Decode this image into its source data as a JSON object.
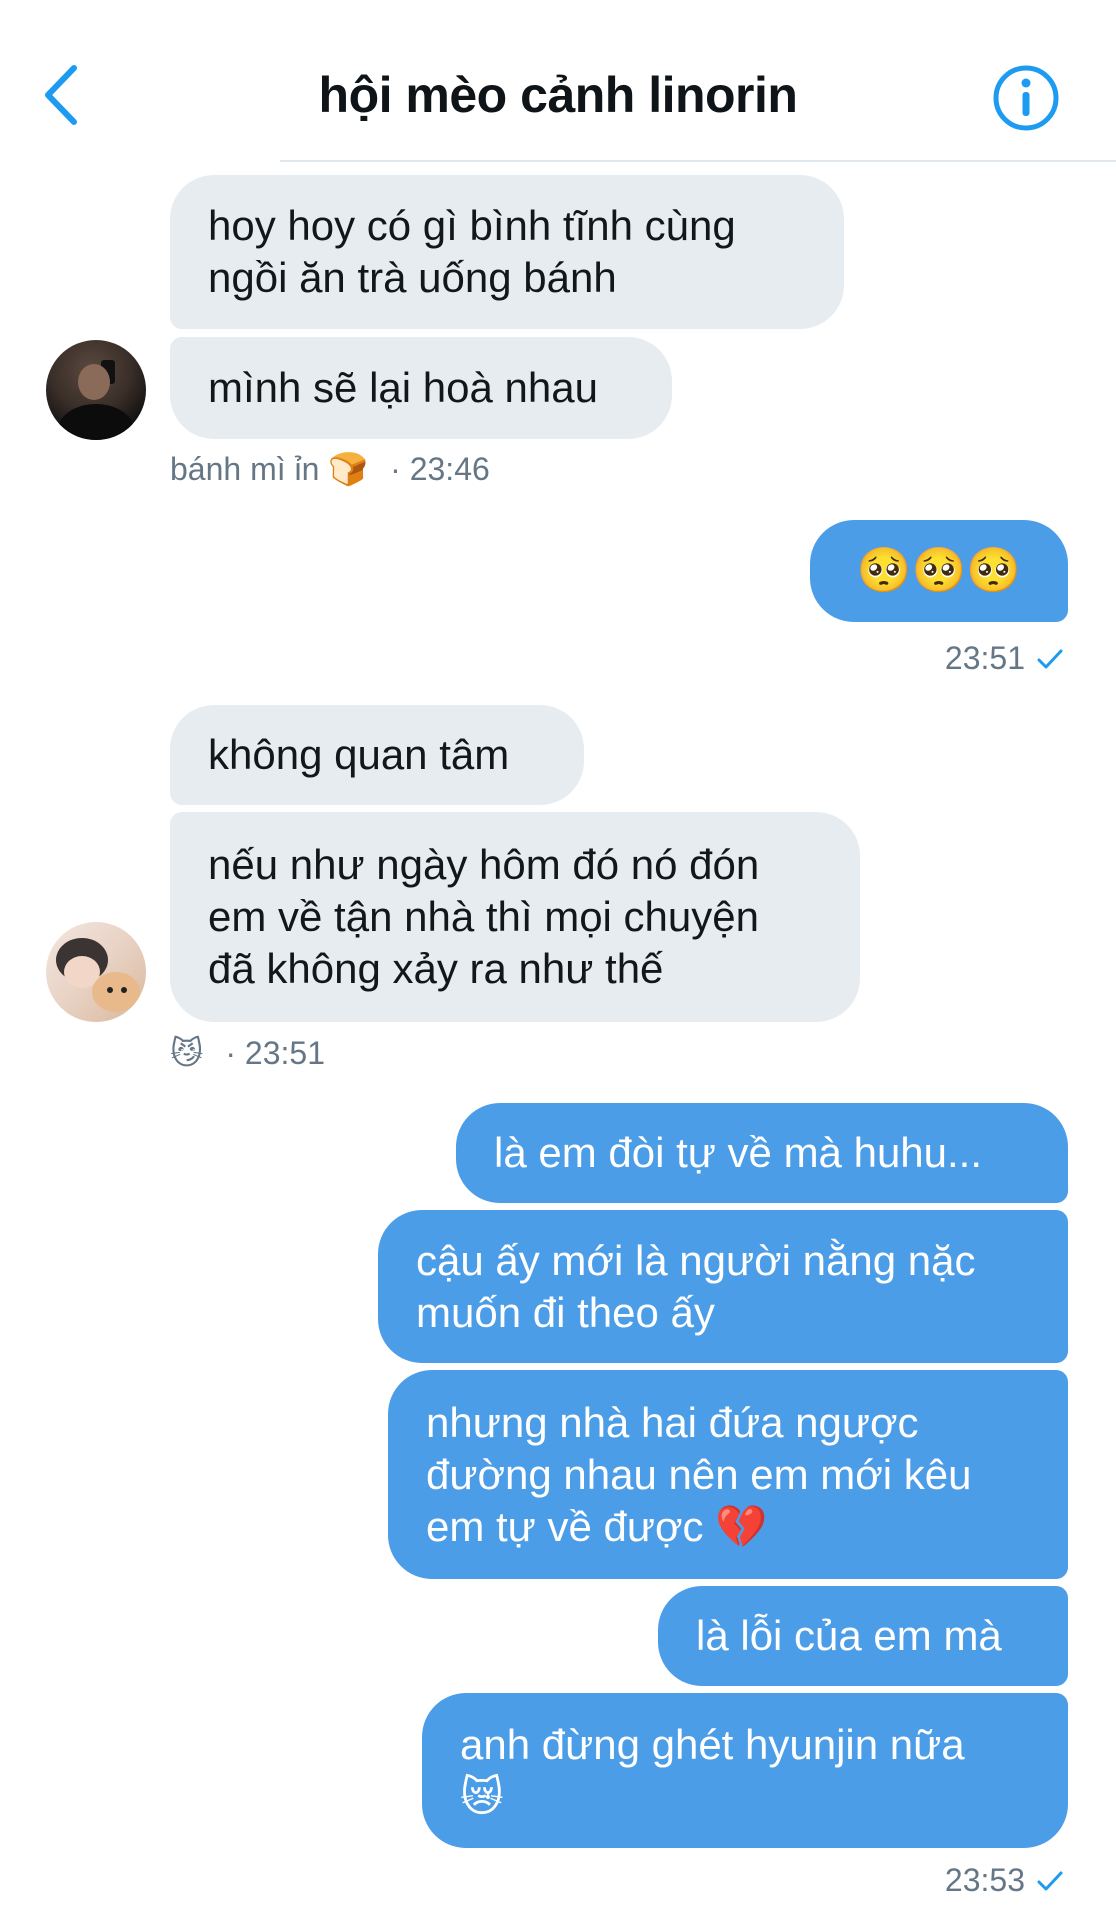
{
  "header": {
    "title": "hội mèo cảnh linorin"
  },
  "icons": {
    "back": "chevron-left-icon",
    "info": "info-circle-icon",
    "check": "checkmark-icon"
  },
  "colors": {
    "accent": "#1d9bf0",
    "outgoing_bubble": "#4c9de8",
    "incoming_bubble": "#e6ecf0"
  },
  "groups": [
    {
      "messages": [
        "hoy hoy có gì bình tĩnh cùng\nngồi ăn trà uống bánh",
        "mình sẽ lại hoà nhau"
      ],
      "sender": "bánh mì ỉn 🍞",
      "time": "· 23:46"
    },
    {
      "messages": [
        "🥺🥺🥺"
      ],
      "time": "23:51"
    },
    {
      "messages": [
        "không quan tâm",
        "nếu như ngày hôm đó nó đón\nem về tận nhà thì mọi chuyện\nđã không xảy ra như thế"
      ],
      "sender": "😼",
      "time": "· 23:51"
    },
    {
      "messages": [
        "là em đòi tự về mà huhu...",
        "cậu ấy mới là người nằng nặc\nmuốn đi theo ấy",
        "nhưng nhà hai đứa ngược\nđường nhau nên em mới kêu\nem tự về được 💔",
        "là lỗi của em mà",
        "anh đừng ghét hyunjin nữa\n😿"
      ],
      "time": "23:53"
    }
  ]
}
